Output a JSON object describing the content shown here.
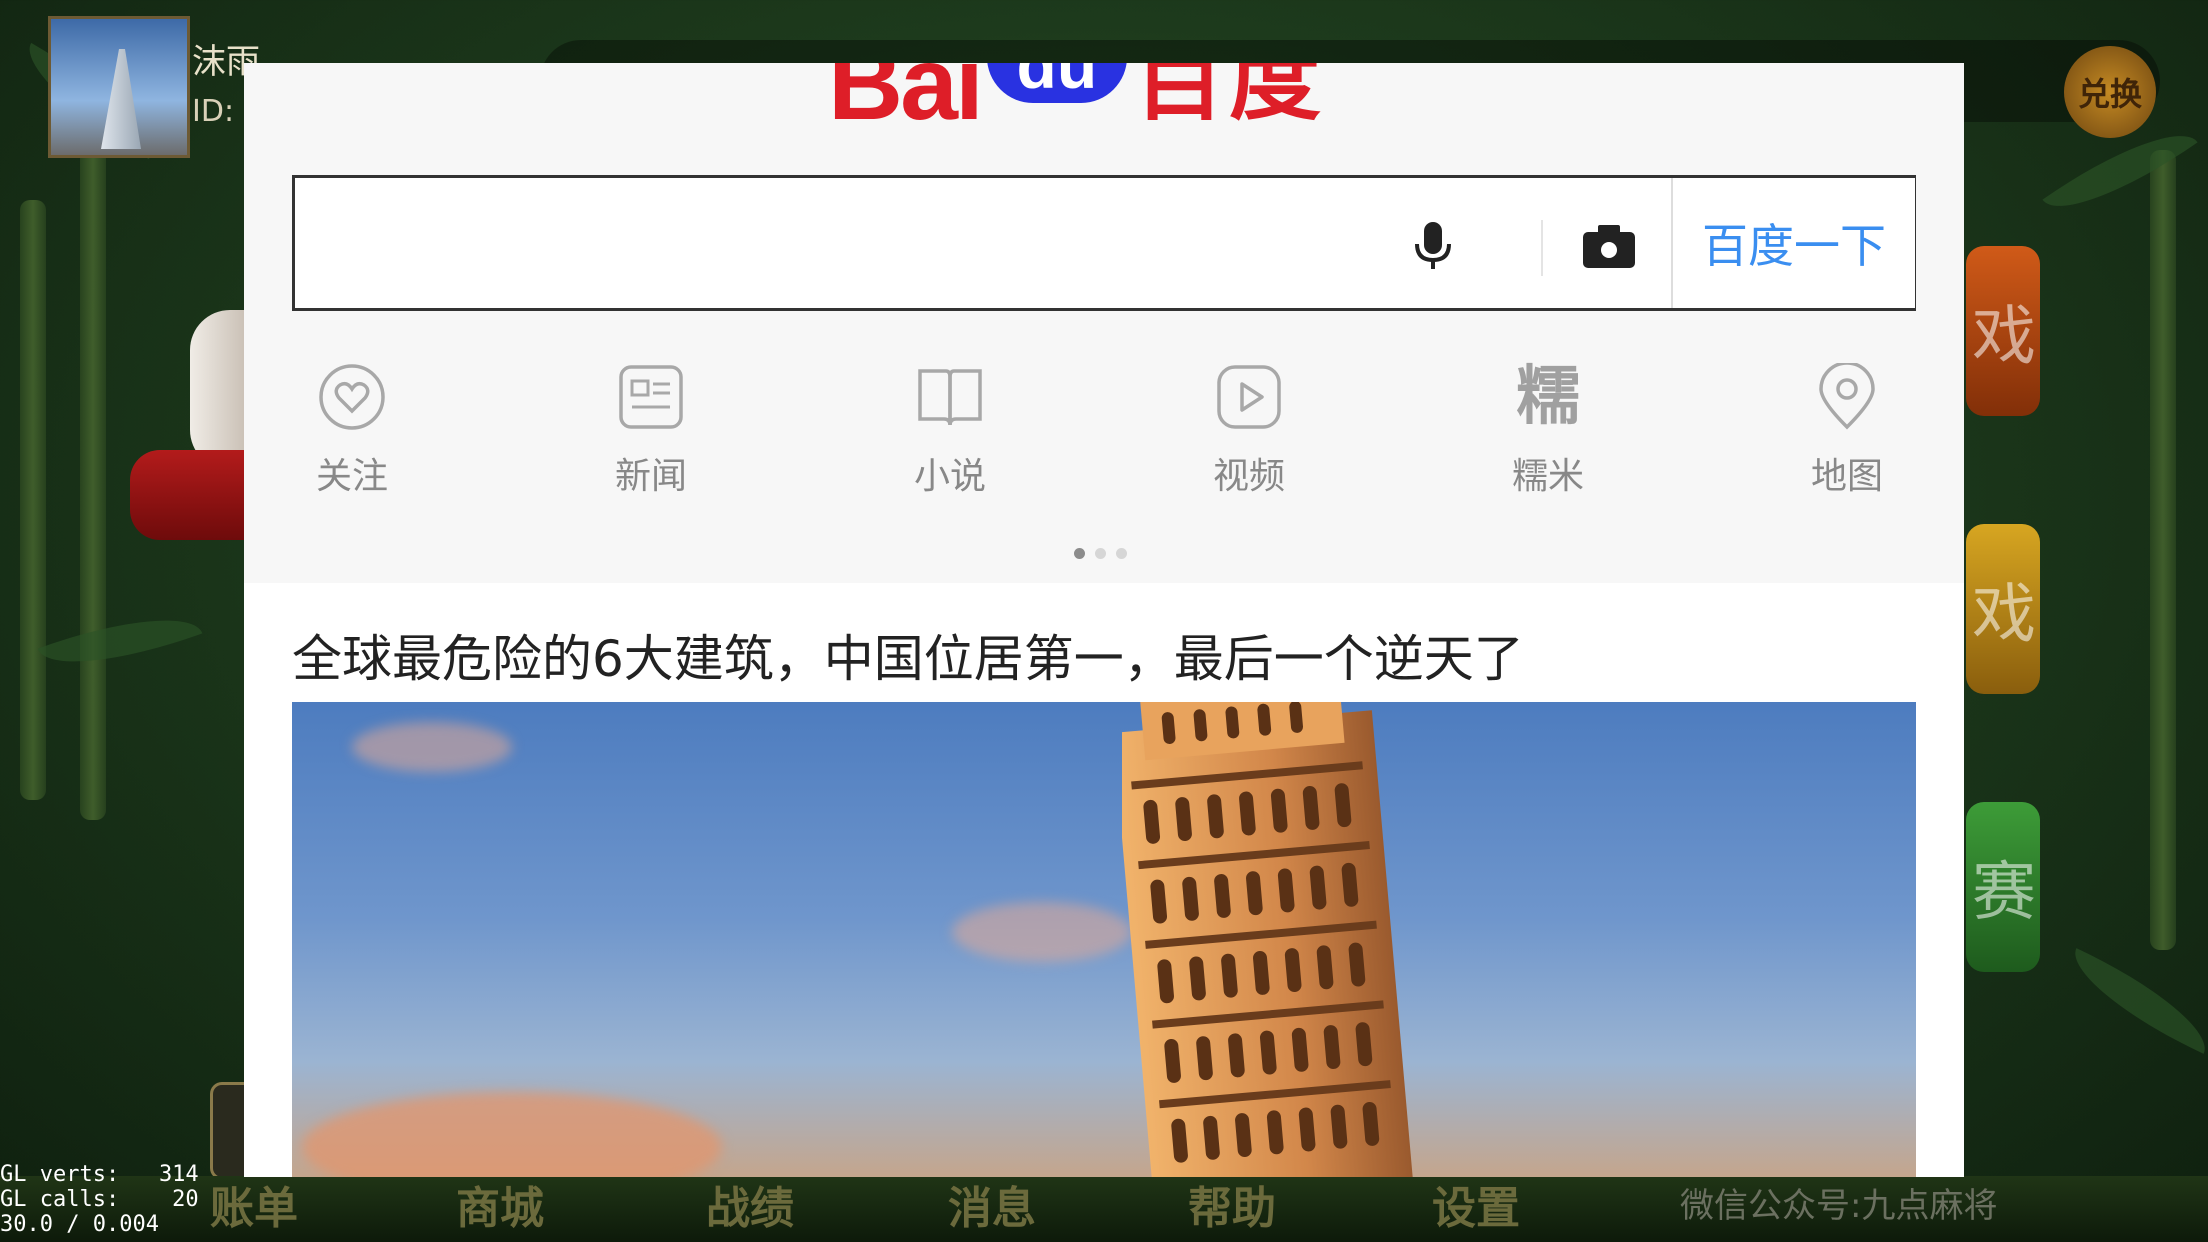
{
  "background_game": {
    "player_name": "沫雨",
    "player_id_prefix": "ID:",
    "exchange_label": "兑换",
    "side_tiles": [
      "戏",
      "戏",
      "赛"
    ],
    "bottom_menu": [
      "账单",
      "商城",
      "战绩",
      "消息",
      "帮助",
      "设置"
    ],
    "wechat_text": "微信公众号:九点麻将",
    "gl_stats": [
      "GL verts:   314",
      "GL calls:    20",
      "30.0 / 0.004"
    ]
  },
  "browser": {
    "logo": {
      "bai": "Bai",
      "paw": "du",
      "cn": "百度",
      "color_red": "#de1e28",
      "color_blue": "#2932e1"
    },
    "search": {
      "value": "",
      "placeholder": "",
      "mic_icon": "microphone-icon",
      "camera_icon": "camera-icon",
      "button_label": "百度一下",
      "button_color": "#3a8ef0"
    },
    "nav": [
      {
        "label": "关注",
        "icon": "heart-icon"
      },
      {
        "label": "新闻",
        "icon": "news-icon"
      },
      {
        "label": "小说",
        "icon": "book-icon"
      },
      {
        "label": "视频",
        "icon": "play-icon"
      },
      {
        "label": "糯米",
        "icon": "糯"
      },
      {
        "label": "地图",
        "icon": "map-pin-icon"
      }
    ],
    "pager": {
      "pages": 3,
      "current": 1
    },
    "feed": {
      "headline": "全球最危险的6大建筑，中国位居第一，最后一个逆天了",
      "image_subject": "leaning-tower-of-pisa"
    }
  }
}
